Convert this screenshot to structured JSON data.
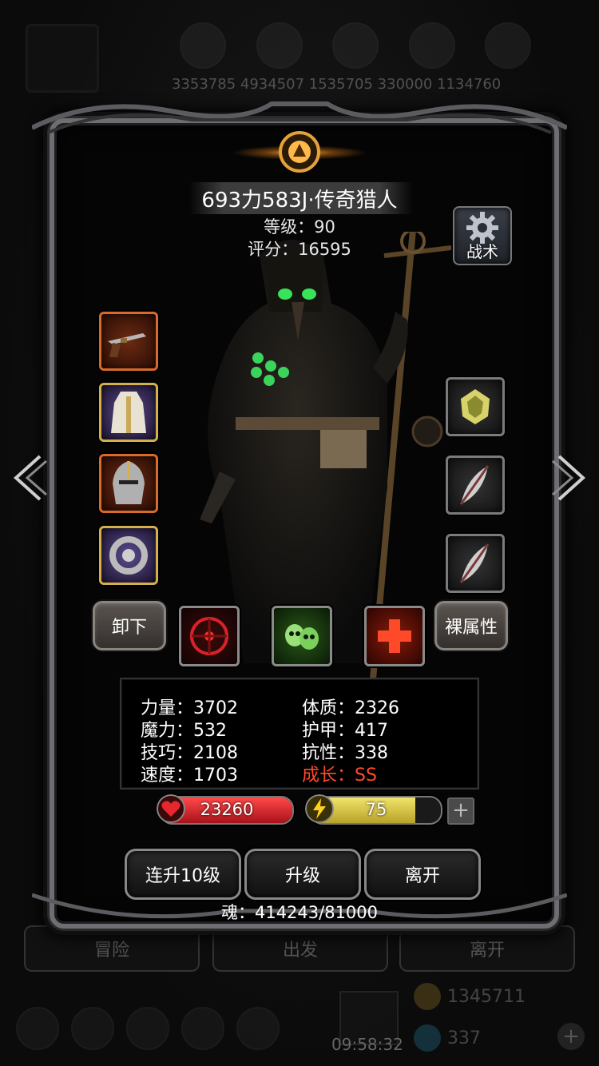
{
  "background": {
    "resource_numbers": "3353785 4934507 1535705 330000 1134760",
    "buttons": [
      "冒险",
      "出发",
      "离开"
    ],
    "time": "09:58:32",
    "coins_gold": "1345711",
    "coins_blue": "337"
  },
  "hero": {
    "name": "693力583J·传奇猎人",
    "level": "等级：90",
    "score": "评分：16595"
  },
  "tactics_label": "战术",
  "equipment_left": [
    {
      "item": "flintlock-pistol",
      "rarity": "orange"
    },
    {
      "item": "white-robe",
      "rarity": "gold"
    },
    {
      "item": "knight-helmet",
      "rarity": "orange"
    },
    {
      "item": "ornate-ring",
      "rarity": "gold"
    }
  ],
  "equipment_right": [
    {
      "item": "gemstone",
      "rarity": "gray"
    },
    {
      "item": "feather",
      "rarity": "gray"
    },
    {
      "item": "feather",
      "rarity": "gray"
    }
  ],
  "actions": {
    "unequip": "卸下",
    "base_attributes": "裸属性"
  },
  "stats": {
    "strength": "力量：3702",
    "magic": "魔力：532",
    "skill": "技巧：2108",
    "speed": "速度：1703",
    "constitution": "体质：2326",
    "armor": "护甲：417",
    "resistance": "抗性：338",
    "growth": "成长：SS"
  },
  "bars": {
    "hp": "23260",
    "energy": "75",
    "energy_fraction": 0.8,
    "plus": "+"
  },
  "buttons": {
    "level_up_10": "连升10级",
    "level_up": "升级",
    "leave": "离开"
  },
  "soul": "魂：414243/81000",
  "colors": {
    "hp_fill": "#d8222a",
    "energy_fill": "#d8c84a",
    "growth_text": "#ff4a2a",
    "orange_rarity": "#d86a2a",
    "gold_rarity": "#d3b04a"
  }
}
